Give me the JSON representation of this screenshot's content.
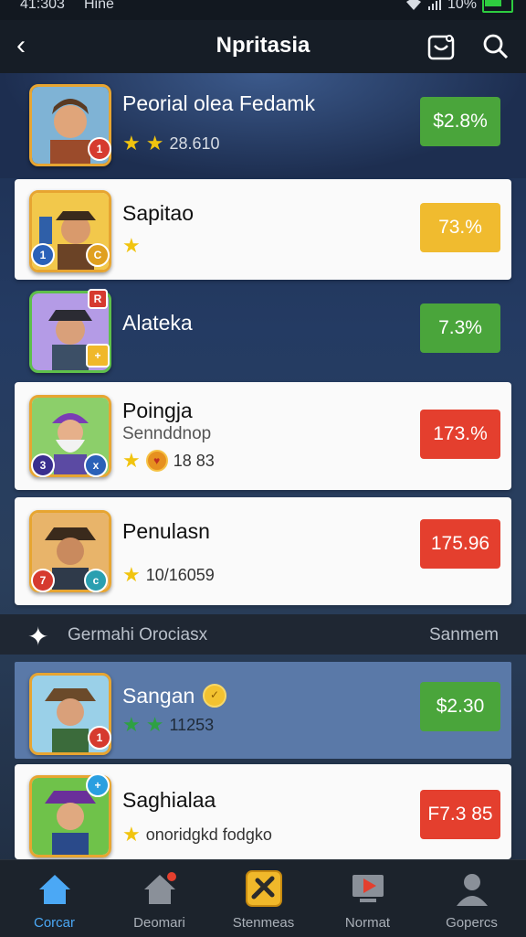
{
  "status": {
    "time": "41:303",
    "carrier": "Hine",
    "battery": "10%"
  },
  "header": {
    "title": "Npritasia"
  },
  "icons": {
    "back": "back-chevron-icon",
    "camera": "camera-icon",
    "search": "search-icon"
  },
  "items": [
    {
      "name": "Peorial olea Fedamk",
      "meta": "28.610",
      "price": "$2.8%",
      "price_color": "#4aa53b"
    },
    {
      "name": "Sapitao",
      "meta": "",
      "price": "73.%",
      "price_color": "#f0bb2f"
    },
    {
      "name": "Alateka",
      "meta": "",
      "price": "7.3%",
      "price_color": "#4aa53b"
    },
    {
      "name": "Poingja",
      "sub": "Sennddnop",
      "meta": "18 83",
      "price": "173.%",
      "price_color": "#e43f2e"
    },
    {
      "name": "Penulasn",
      "meta": "10/16059",
      "price": "175.96",
      "price_color": "#e43f2e"
    },
    {
      "name": "Sangan",
      "meta": "11253",
      "price": "$2.30",
      "price_color": "#4aa53b"
    },
    {
      "name": "Saghialaa",
      "meta": "onoridgkd fodgko",
      "price": "F7.3 85",
      "price_color": "#e43f2e"
    }
  ],
  "section": {
    "title": "Germahi Orociasx",
    "right": "Sanmem"
  },
  "nav": [
    {
      "label": "Corcar",
      "icon": "home-icon"
    },
    {
      "label": "Deomari",
      "icon": "house-notify-icon"
    },
    {
      "label": "Stenmeas",
      "icon": "game-controller-icon"
    },
    {
      "label": "Normat",
      "icon": "monitor-icon"
    },
    {
      "label": "Gopercs",
      "icon": "profile-icon"
    }
  ]
}
